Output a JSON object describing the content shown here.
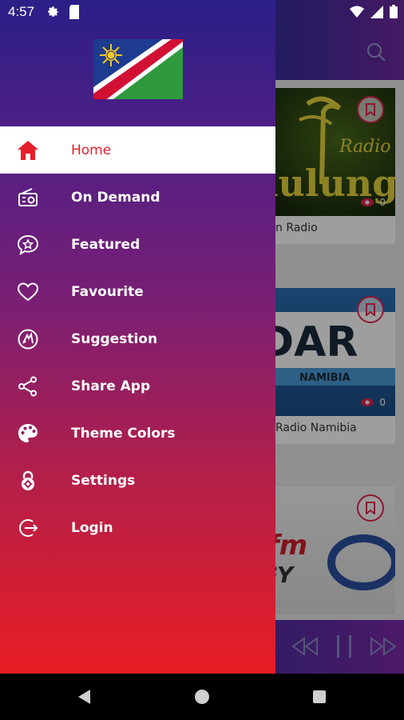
{
  "status_bar": {
    "time": "4:57"
  },
  "drawer": {
    "menu": [
      {
        "label": "Home",
        "icon": "home-icon",
        "active": true
      },
      {
        "label": "On Demand",
        "icon": "radio-icon",
        "active": false
      },
      {
        "label": "Featured",
        "icon": "star-chat-icon",
        "active": false
      },
      {
        "label": "Favourite",
        "icon": "heart-icon",
        "active": false
      },
      {
        "label": "Suggestion",
        "icon": "suggestion-icon",
        "active": false
      },
      {
        "label": "Share App",
        "icon": "share-icon",
        "active": false
      },
      {
        "label": "Theme Colors",
        "icon": "palette-icon",
        "active": false
      },
      {
        "label": "Settings",
        "icon": "settings-lock-icon",
        "active": false
      },
      {
        "label": "Login",
        "icon": "login-icon",
        "active": false
      }
    ]
  },
  "background": {
    "cards": [
      {
        "title": "n Radio",
        "views": "0"
      },
      {
        "title": "Radio Namibia",
        "views": "0"
      },
      {
        "title": "",
        "views": ""
      }
    ]
  },
  "colors": {
    "active_label": "#e8202a",
    "drawer_top": "#2a1f86",
    "drawer_bottom": "#e81d24",
    "accent": "#e4244f"
  }
}
